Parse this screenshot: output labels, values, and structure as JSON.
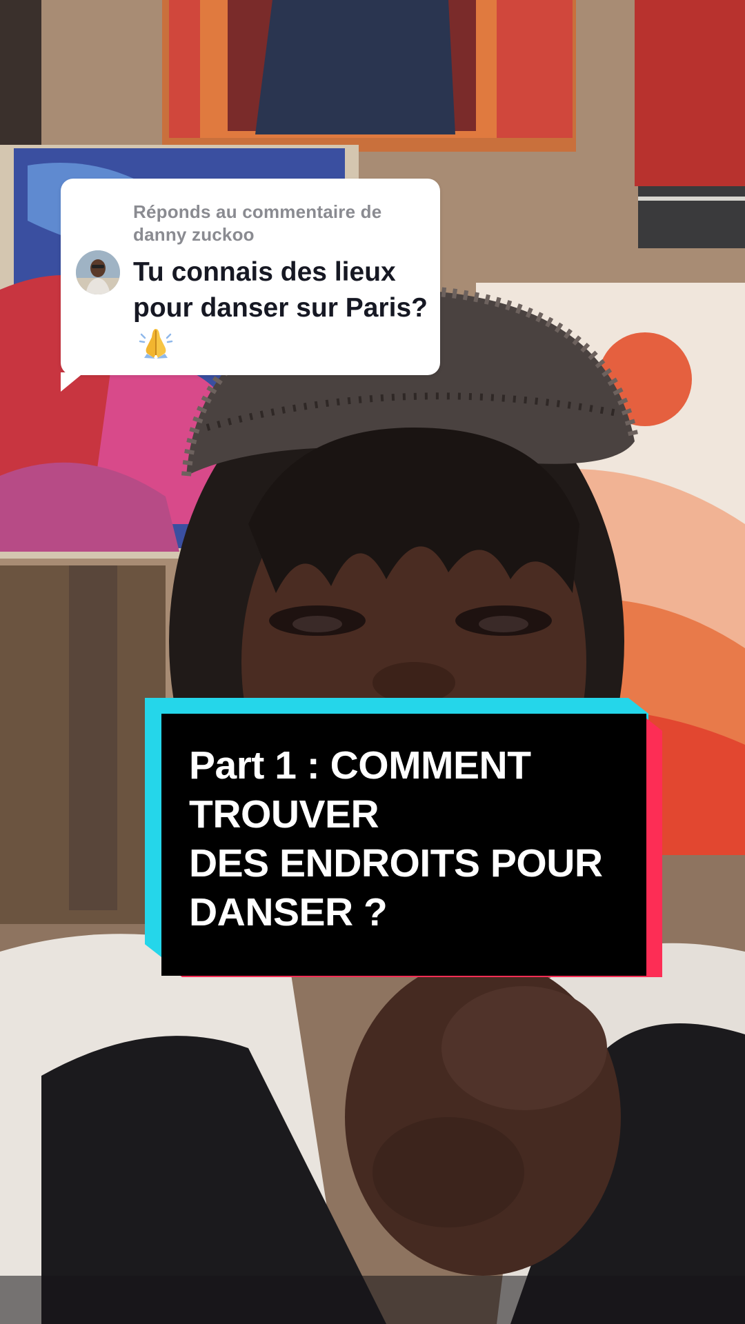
{
  "reply": {
    "header": "Réponds au commentaire de danny zuckoo",
    "comment": "Tu connais des lieux pour danser sur Paris?",
    "emoji_icon": "folded-hands-icon"
  },
  "title_card": {
    "lines": [
      "Part 1 : COMMENT",
      "TROUVER",
      "DES ENDROITS POUR",
      "DANSER ?"
    ],
    "colors": {
      "cyan": "#25d6ea",
      "red": "#fd2d55",
      "background": "#000000",
      "text": "#ffffff"
    }
  }
}
